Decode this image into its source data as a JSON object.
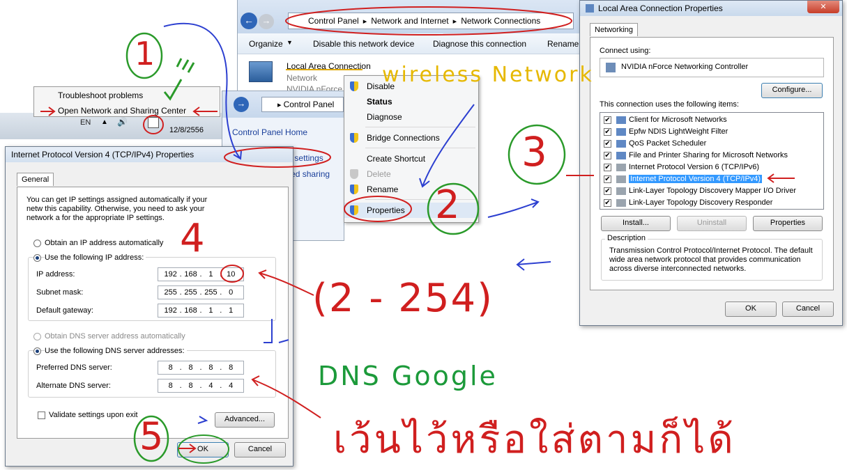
{
  "tray_menu": {
    "item1": "Troubleshoot problems",
    "item2": "Open Network and Sharing Center"
  },
  "taskbar": {
    "lang": "EN",
    "date": "12/8/2556"
  },
  "explorer": {
    "breadcrumb": [
      "Control Panel",
      "Network and Internet",
      "Network Connections"
    ],
    "toolbar": [
      "Organize",
      "Disable this network device",
      "Diagnose this connection",
      "Rename"
    ],
    "adapter": {
      "name": "Local Area Connection",
      "line2": "Network",
      "line3": "NVIDIA nForce"
    }
  },
  "context_menu": {
    "items": [
      "Disable",
      "Status",
      "Diagnose",
      "Bridge Connections",
      "Create Shortcut",
      "Delete",
      "Rename",
      "Properties"
    ]
  },
  "control_panel": {
    "breadcrumb": "Control Panel",
    "links": [
      "Control Panel Home",
      "Change adapter settings",
      "Change advanced sharing settings"
    ]
  },
  "lac_props": {
    "title": "Local Area Connection Properties",
    "tab": "Networking",
    "connect_using_label": "Connect using:",
    "adapter": "NVIDIA nForce Networking Controller",
    "configure": "Configure...",
    "items_label": "This connection uses the following items:",
    "items": [
      "Client for Microsoft Networks",
      "Epfw NDIS LightWeight Filter",
      "QoS Packet Scheduler",
      "File and Printer Sharing for Microsoft Networks",
      "Internet Protocol Version 6 (TCP/IPv6)",
      "Internet Protocol Version 4 (TCP/IPv4)",
      "Link-Layer Topology Discovery Mapper I/O Driver",
      "Link-Layer Topology Discovery Responder"
    ],
    "install": "Install...",
    "uninstall": "Uninstall",
    "properties": "Properties",
    "description_label": "Description",
    "description": "Transmission Control Protocol/Internet Protocol. The default wide area network protocol that provides communication across diverse interconnected networks.",
    "ok": "OK",
    "cancel": "Cancel"
  },
  "ipv4": {
    "title": "Internet Protocol Version 4 (TCP/IPv4) Properties",
    "tab": "General",
    "intro": "You can get IP settings assigned automatically if your netw this capability. Otherwise, you need to ask your network a for the appropriate IP settings.",
    "auto_ip": "Obtain an IP address automatically",
    "use_ip": "Use the following IP address:",
    "ip_label": "IP address:",
    "ip": [
      "192",
      "168",
      "1",
      "10"
    ],
    "mask_label": "Subnet mask:",
    "mask": [
      "255",
      "255",
      "255",
      "0"
    ],
    "gw_label": "Default gateway:",
    "gw": [
      "192",
      "168",
      "1",
      "1"
    ],
    "auto_dns": "Obtain DNS server address automatically",
    "use_dns": "Use the following DNS server addresses:",
    "pref_label": "Preferred DNS server:",
    "pref": [
      "8",
      "8",
      "8",
      "8"
    ],
    "alt_label": "Alternate DNS server:",
    "alt": [
      "8",
      "8",
      "4",
      "4"
    ],
    "validate": "Validate settings upon exit",
    "advanced": "Advanced...",
    "ok": "OK",
    "cancel": "Cancel"
  },
  "annotations": {
    "n1": "1",
    "n2": "2",
    "n3": "3",
    "n4": "4",
    "n5": "5",
    "wireless": "wireless Network",
    "range": "(2 - 254)",
    "dns_google": "DNS Google",
    "thai": "เว้นไว้หรือใส่ตามก็ได้"
  }
}
